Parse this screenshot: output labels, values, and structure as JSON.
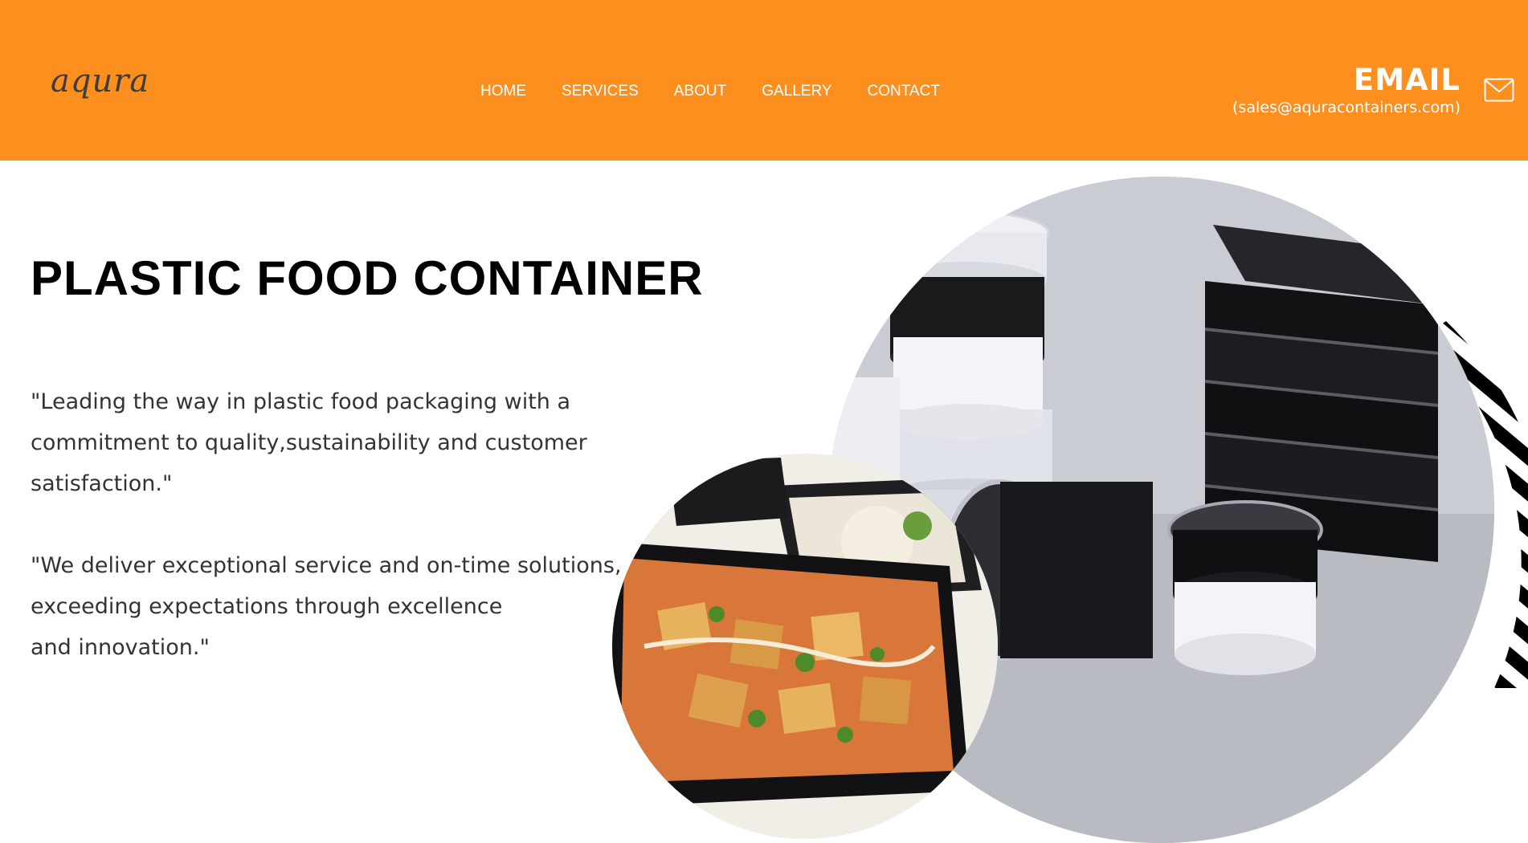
{
  "brand": {
    "logo_text": "aqura",
    "accent_color": "#fc8f1e"
  },
  "nav": {
    "items": [
      {
        "label": "HOME"
      },
      {
        "label": "SERVICES"
      },
      {
        "label": "ABOUT"
      },
      {
        "label": "GALLERY"
      },
      {
        "label": "CONTACT"
      }
    ]
  },
  "contact": {
    "title": "EMAIL",
    "address": "(sales@aquracontainers.com)",
    "icon": "mail-icon"
  },
  "hero": {
    "title": "PLASTIC FOOD CONTAINER",
    "quote1_lines": [
      "\"Leading the way in plastic food packaging with a",
      "commitment to quality,sustainability and customer",
      "satisfaction.\""
    ],
    "quote2_lines": [
      "\"We deliver exceptional service and on-time solutions,",
      "exceeding expectations through excellence",
      "and innovation.\""
    ]
  }
}
